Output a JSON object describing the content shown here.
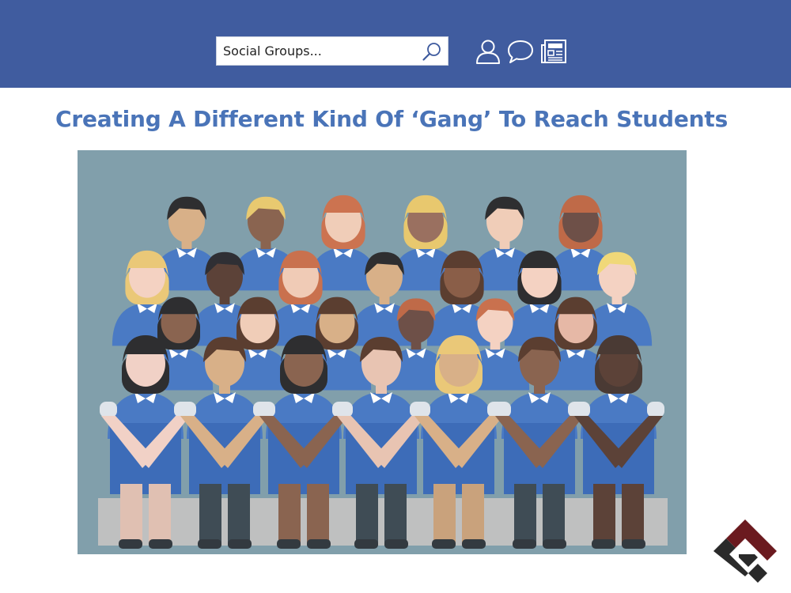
{
  "topbar": {
    "search": {
      "value": "",
      "placeholder": "Social Groups..."
    },
    "icons": [
      "search-icon",
      "profile-icon",
      "chat-bubble-icon",
      "newsfeed-icon"
    ],
    "color": "#405c9f"
  },
  "article": {
    "title": "Creating A Different Kind Of ‘Gang’ To Reach Students",
    "title_color": "#4a74b8",
    "image": "illustration of a group class photo of students in blue uniforms"
  },
  "brand_logo": {
    "colors": [
      "#6b1a1f",
      "#2a2a2a"
    ]
  }
}
